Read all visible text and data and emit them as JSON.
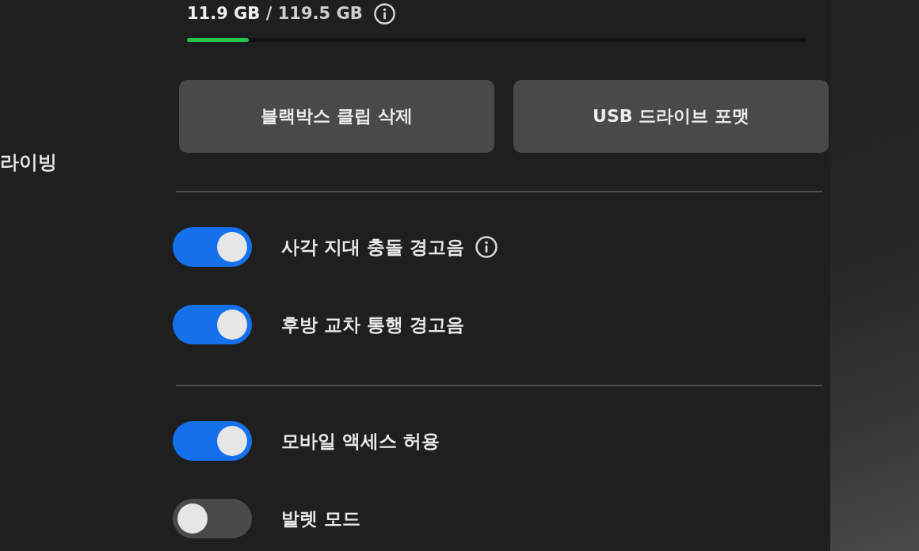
{
  "sidebar": {
    "items": [
      {
        "label": "라이빙"
      }
    ]
  },
  "storage": {
    "usage": "**11.9 GB** / 119.5 GB",
    "level": 0.1
  },
  "buttons": [
    {
      "label": "블랙박스 클립 삭제"
    },
    {
      "label": "USB 드라이브 포맷"
    }
  ],
  "settings_groups": [
    [
      {
        "label": "사각 지대 충돌 경고음",
        "on": true,
        "info": true
      },
      {
        "label": "후방 교차 통행 경고음",
        "on": true,
        "info": false
      }
    ],
    [
      {
        "label": "모바일 액세스 허용",
        "on": true,
        "info": false
      },
      {
        "label": "발렛 모드",
        "on": false,
        "info": false
      }
    ]
  ]
}
